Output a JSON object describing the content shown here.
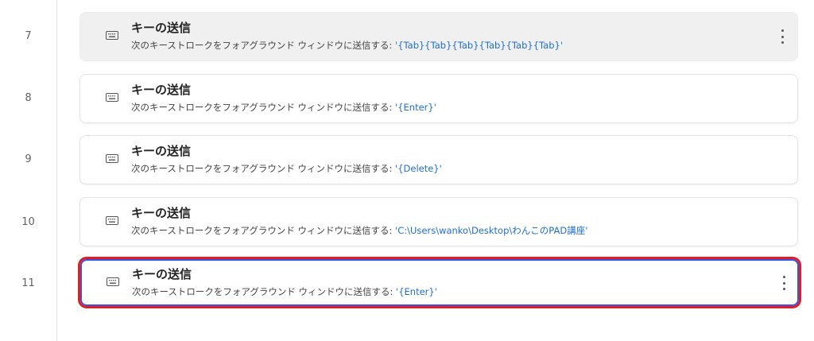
{
  "steps": [
    {
      "number": "7",
      "icon": "keyboard-icon",
      "title": "キーの送信",
      "description": "次のキーストロークをフォアグラウンド ウィンドウに送信する:",
      "value": "'{Tab}{Tab}{Tab}{Tab}{Tab}{Tab}'",
      "state": "hovered"
    },
    {
      "number": "8",
      "icon": "keyboard-icon",
      "title": "キーの送信",
      "description": "次のキーストロークをフォアグラウンド ウィンドウに送信する:",
      "value": "'{Enter}'",
      "state": "normal"
    },
    {
      "number": "9",
      "icon": "keyboard-icon",
      "title": "キーの送信",
      "description": "次のキーストロークをフォアグラウンド ウィンドウに送信する:",
      "value": "'{Delete}'",
      "state": "normal"
    },
    {
      "number": "10",
      "icon": "keyboard-icon",
      "title": "キーの送信",
      "description": "次のキーストロークをフォアグラウンド ウィンドウに送信する:",
      "value": "'C:\\Users\\wanko\\Desktop\\わんこのPAD講座'",
      "state": "normal"
    },
    {
      "number": "11",
      "icon": "keyboard-icon",
      "title": "キーの送信",
      "description": "次のキーストロークをフォアグラウンド ウィンドウに送信する:",
      "value": "'{Enter}'",
      "state": "selected"
    }
  ],
  "colors": {
    "value_text": "#1f6fd0",
    "selection_outline": "#e21b24",
    "selection_border": "#3355e8",
    "hover_background": "#f0f0f0"
  }
}
